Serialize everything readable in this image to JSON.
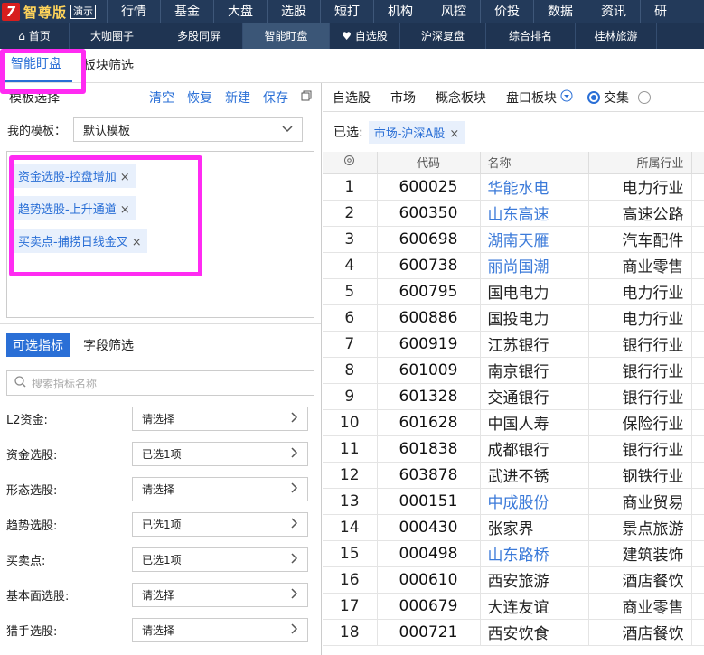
{
  "app": {
    "logo_mark": "7",
    "name": "智尊版",
    "demo": "演示"
  },
  "menu": [
    "行情",
    "基金",
    "大盘",
    "选股",
    "短打",
    "机构",
    "风控",
    "价投",
    "数据",
    "资讯",
    "研"
  ],
  "tabs": [
    "首页",
    "大咖圈子",
    "多股同屏",
    "智能盯盘",
    "自选股",
    "沪深复盘",
    "综合排名",
    "桂林旅游"
  ],
  "active_tab": 3,
  "subtabs": [
    "智能盯盘",
    "板块筛选"
  ],
  "left": {
    "title": "模板选择",
    "actions": [
      "清空",
      "恢复",
      "新建",
      "保存"
    ],
    "my_template_label": "我的模板：",
    "my_template_value": "默认模板",
    "tags": [
      "资金选股-控盘增加",
      "趋势选股-上升通道",
      "买卖点-捕捞日线金叉"
    ],
    "seg_on": "可选指标",
    "seg_off": "字段筛选",
    "search_placeholder": "搜索指标名称",
    "filters": [
      {
        "label": "L2资金:",
        "value": "请选择"
      },
      {
        "label": "资金选股:",
        "value": "已选1项"
      },
      {
        "label": "形态选股:",
        "value": "请选择"
      },
      {
        "label": "趋势选股:",
        "value": "已选1项"
      },
      {
        "label": "买卖点:",
        "value": "已选1项"
      },
      {
        "label": "基本面选股:",
        "value": "请选择"
      },
      {
        "label": "猎手选股:",
        "value": "请选择"
      }
    ]
  },
  "right": {
    "tabs": [
      "自选股",
      "市场",
      "概念板块",
      "盘口板块"
    ],
    "radio_label": "交集",
    "selected_label": "已选:",
    "selected_chip": "市场-沪深A股",
    "columns": [
      "代码",
      "名称",
      "所属行业"
    ],
    "rows": [
      {
        "i": "1",
        "code": "600025",
        "name": "华能水电",
        "ind": "电力行业",
        "blue": true
      },
      {
        "i": "2",
        "code": "600350",
        "name": "山东高速",
        "ind": "高速公路",
        "blue": true
      },
      {
        "i": "3",
        "code": "600698",
        "name": "湖南天雁",
        "ind": "汽车配件",
        "blue": true
      },
      {
        "i": "4",
        "code": "600738",
        "name": "丽尚国潮",
        "ind": "商业零售",
        "blue": true
      },
      {
        "i": "5",
        "code": "600795",
        "name": "国电电力",
        "ind": "电力行业",
        "blue": false
      },
      {
        "i": "6",
        "code": "600886",
        "name": "国投电力",
        "ind": "电力行业",
        "blue": false
      },
      {
        "i": "7",
        "code": "600919",
        "name": "江苏银行",
        "ind": "银行行业",
        "blue": false
      },
      {
        "i": "8",
        "code": "601009",
        "name": "南京银行",
        "ind": "银行行业",
        "blue": false
      },
      {
        "i": "9",
        "code": "601328",
        "name": "交通银行",
        "ind": "银行行业",
        "blue": false
      },
      {
        "i": "10",
        "code": "601628",
        "name": "中国人寿",
        "ind": "保险行业",
        "blue": false
      },
      {
        "i": "11",
        "code": "601838",
        "name": "成都银行",
        "ind": "银行行业",
        "blue": false
      },
      {
        "i": "12",
        "code": "603878",
        "name": "武进不锈",
        "ind": "钢铁行业",
        "blue": false
      },
      {
        "i": "13",
        "code": "000151",
        "name": "中成股份",
        "ind": "商业贸易",
        "blue": true
      },
      {
        "i": "14",
        "code": "000430",
        "name": "张家界",
        "ind": "景点旅游",
        "blue": false
      },
      {
        "i": "15",
        "code": "000498",
        "name": "山东路桥",
        "ind": "建筑装饰",
        "blue": true
      },
      {
        "i": "16",
        "code": "000610",
        "name": "西安旅游",
        "ind": "酒店餐饮",
        "blue": false
      },
      {
        "i": "17",
        "code": "000679",
        "name": "大连友谊",
        "ind": "商业零售",
        "blue": false
      },
      {
        "i": "18",
        "code": "000721",
        "name": "西安饮食",
        "ind": "酒店餐饮",
        "blue": false
      }
    ]
  }
}
